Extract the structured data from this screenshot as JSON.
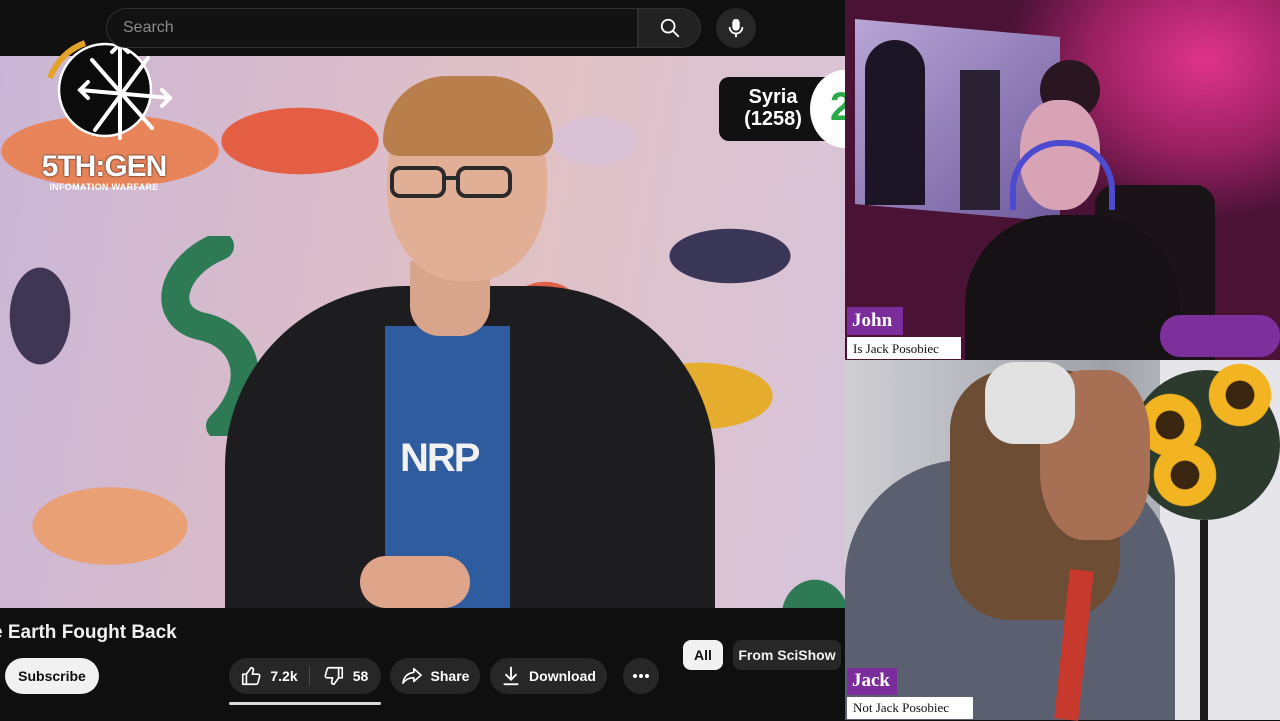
{
  "youtube": {
    "search": {
      "placeholder": "Search"
    },
    "video": {
      "overlay": {
        "country": "Syria\n(1258)",
        "circle_number": "2"
      },
      "shirt_text": "NRP",
      "channel_logo": {
        "brand": "5TH:GEN",
        "subtitle": "INFOMATION WARFARE"
      }
    },
    "title": "e Earth Fought Back",
    "actions": {
      "subscribe": "Subscribe",
      "likes": "7.2k",
      "dislikes": "58",
      "share": "Share",
      "download": "Download"
    },
    "chips": [
      "All",
      "From SciShow"
    ]
  },
  "cameras": {
    "john": {
      "name": "John",
      "caption": "Is Jack Posobiec"
    },
    "jack": {
      "name": "Jack",
      "caption": "Not Jack Posobiec"
    }
  },
  "colors": {
    "name_tag": "#7b2d9b",
    "john_light": "#e0348a",
    "youtube_bg": "#0f0f0f"
  }
}
